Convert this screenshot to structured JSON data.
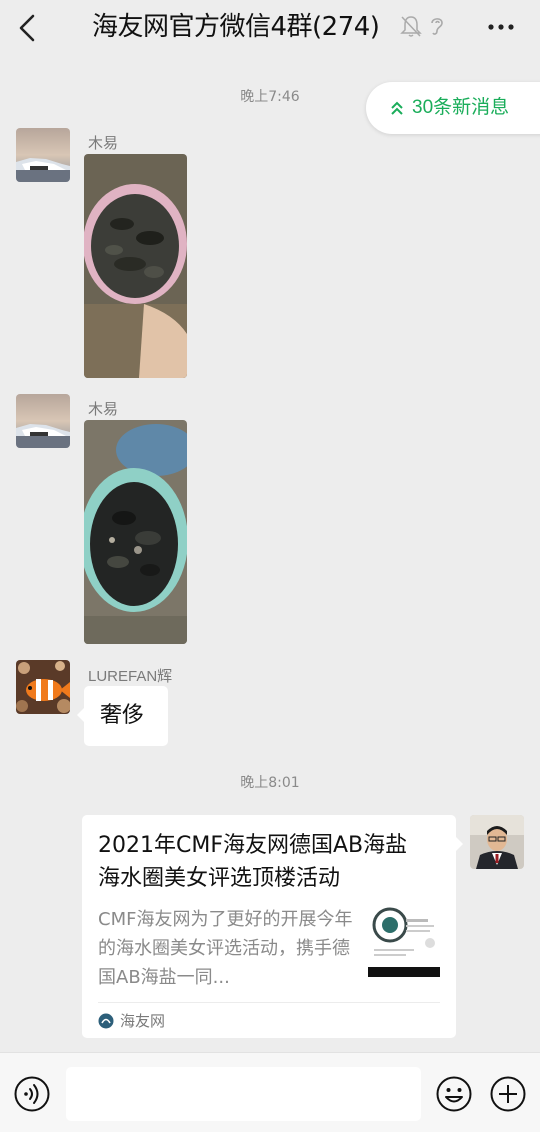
{
  "header": {
    "title": "海友网官方微信4群(274)"
  },
  "new_messages": {
    "label": "30条新消息"
  },
  "colors": {
    "accent": "#1aad5a",
    "background": "#ededed",
    "bubble": "#ffffff"
  },
  "messages": [
    {
      "time": "晚上7:46"
    },
    {
      "sender": "木易",
      "type": "image",
      "avatar_icon": "car-photo-avatar"
    },
    {
      "sender": "木易",
      "type": "image",
      "avatar_icon": "car-photo-avatar"
    },
    {
      "sender": "LUREFAN辉",
      "type": "text",
      "text": "奢侈",
      "avatar_icon": "clownfish-avatar"
    },
    {
      "time": "晚上8:01"
    },
    {
      "type": "link-card",
      "card_title": "2021年CMF海友网德国AB海盐海水圈美女评选顶楼活动",
      "card_desc": "CMF海友网为了更好的开展今年的海水圈美女评选活动，携手德国AB海盐一同...",
      "card_source": "海友网",
      "avatar_icon": "man-in-suit-avatar"
    }
  ],
  "input_bar": {
    "voice_icon": "voice-icon",
    "emoji_icon": "emoji-icon",
    "plus_icon": "plus-icon"
  }
}
